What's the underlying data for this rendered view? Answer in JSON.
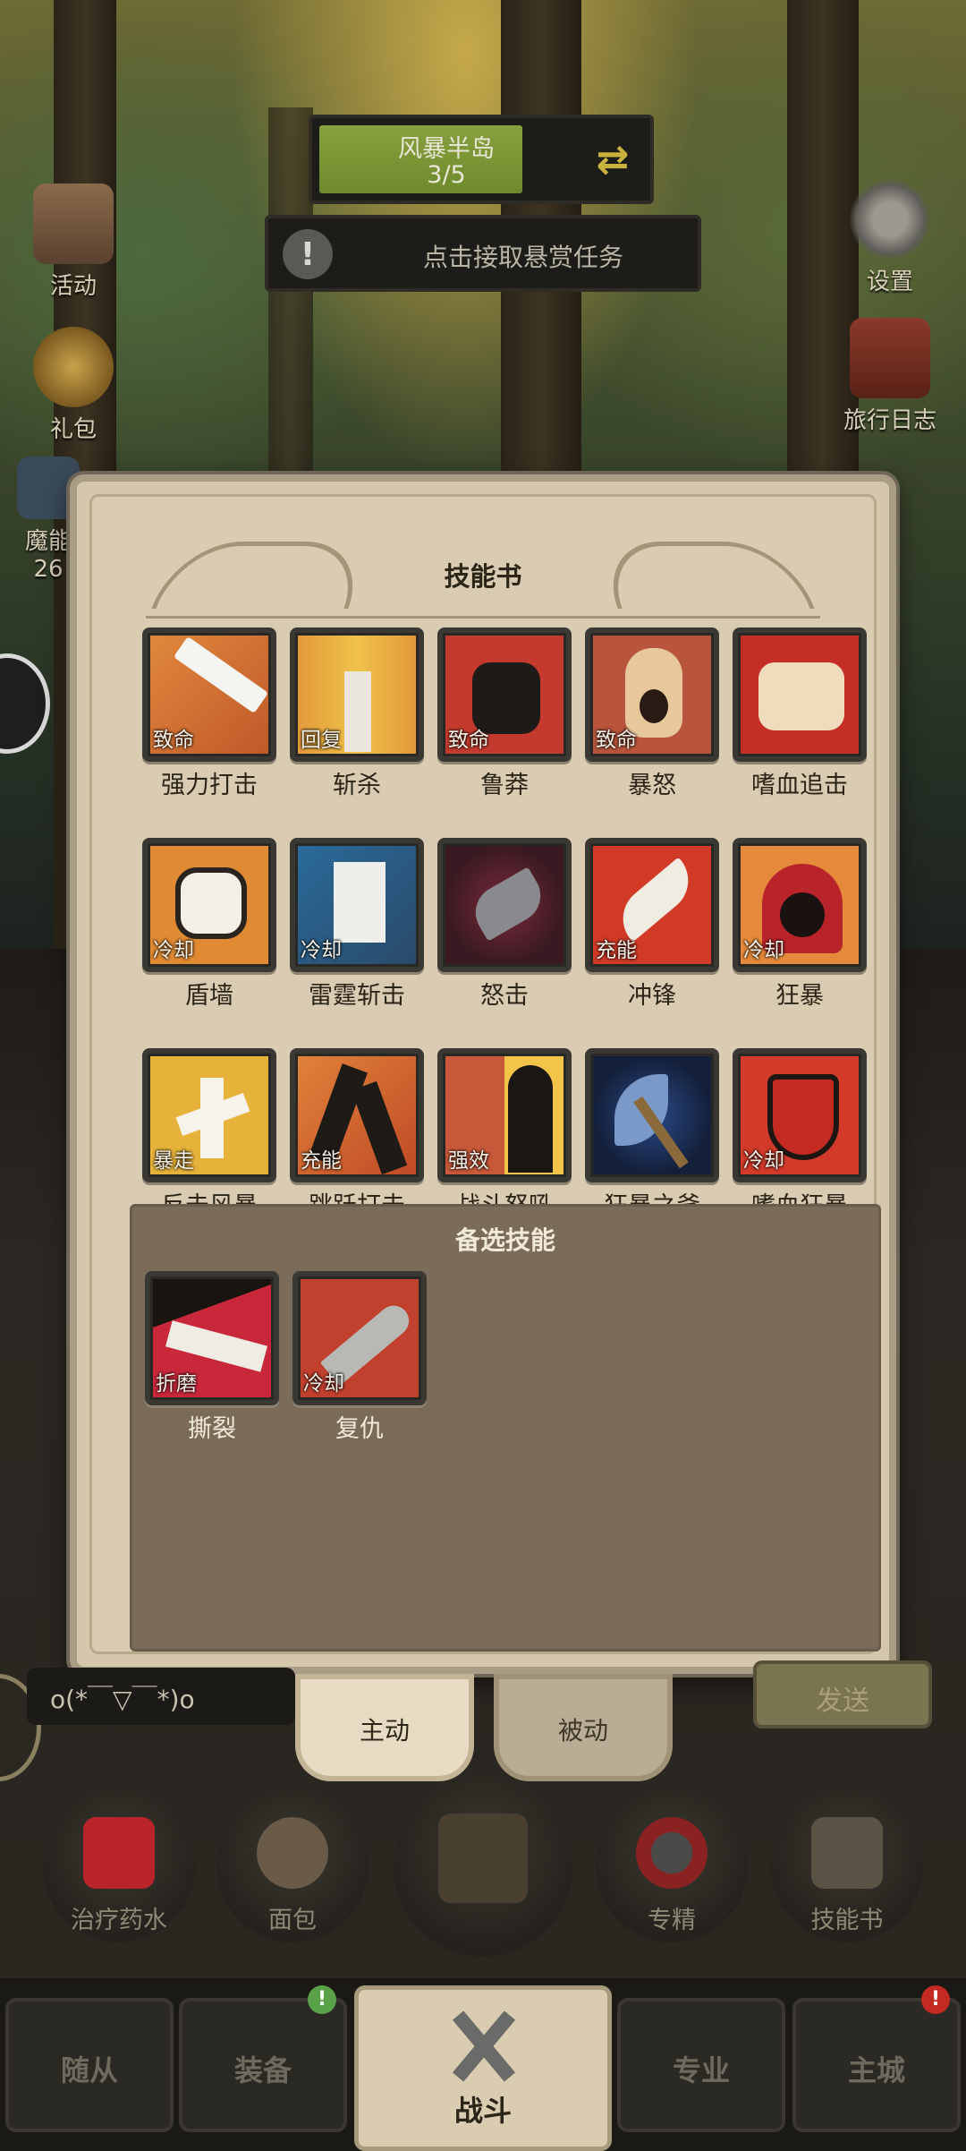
{
  "hud": {
    "stage_name": "风暴半岛",
    "stage_progress": "3/5",
    "stage_progress_fraction": 0.6,
    "bounty_text": "点击接取悬赏任务",
    "left_icons": [
      "活动",
      "礼包",
      "魔能"
    ],
    "left_value": "26",
    "right_icons": [
      "设置",
      "旅行日志"
    ]
  },
  "panel": {
    "title": "技能书",
    "skills": [
      {
        "name": "强力打击",
        "tag": "致命"
      },
      {
        "name": "斩杀",
        "tag": "回复"
      },
      {
        "name": "鲁莽",
        "tag": "致命"
      },
      {
        "name": "暴怒",
        "tag": "致命"
      },
      {
        "name": "嗜血追击",
        "tag": ""
      },
      {
        "name": "盾墙",
        "tag": "冷却"
      },
      {
        "name": "雷霆斩击",
        "tag": "冷却"
      },
      {
        "name": "怒击",
        "tag": ""
      },
      {
        "name": "冲锋",
        "tag": "充能"
      },
      {
        "name": "狂暴",
        "tag": "冷却"
      },
      {
        "name": "反击风暴",
        "tag": "暴走"
      },
      {
        "name": "跳跃打击",
        "tag": "充能"
      },
      {
        "name": "战斗怒吼",
        "tag": "强效"
      },
      {
        "name": "狂暴之斧",
        "tag": ""
      },
      {
        "name": "嗜血狂暴",
        "tag": "冷却"
      }
    ],
    "alt_title": "备选技能",
    "alt_skills": [
      {
        "name": "撕裂",
        "tag": "折磨"
      },
      {
        "name": "复仇",
        "tag": "冷却"
      }
    ]
  },
  "chat": {
    "input_value": "o(*￣▽￣*)o",
    "send_label": "发送"
  },
  "tabs": {
    "active": "主动",
    "passive": "被动"
  },
  "actions": [
    "治疗药水",
    "面包",
    "专精",
    "技能书"
  ],
  "nav": {
    "items": [
      "随从",
      "装备",
      "战斗",
      "专业",
      "主城"
    ],
    "badge_green": "!",
    "badge_red": "!"
  },
  "colors": {
    "panel_bg": "#d4c7ac",
    "alt_bg": "#7b6c5a",
    "stage_fill": "#88a03e"
  }
}
